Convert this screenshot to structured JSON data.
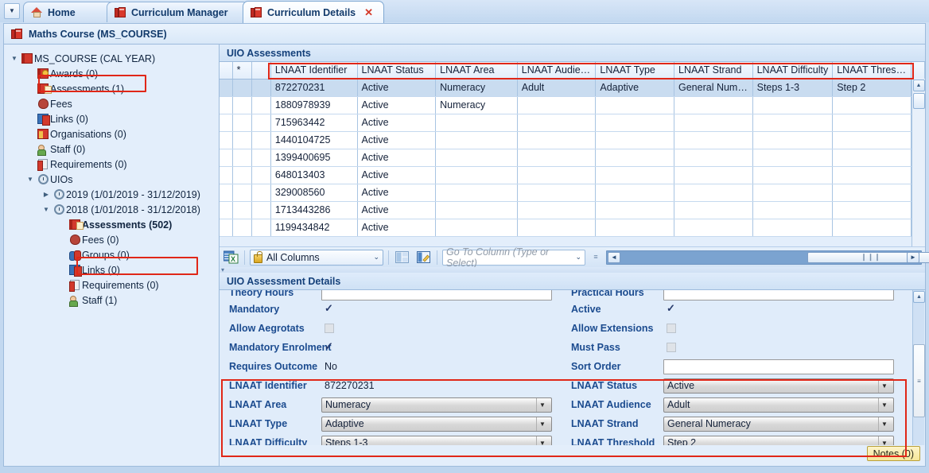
{
  "window": {
    "breadcrumb_title": "Maths Course (MS_COURSE)",
    "breadcrumb_icon": "book-icon"
  },
  "tabs": {
    "overflow_arrow": "▼",
    "items": [
      {
        "label": "Home",
        "icon": "home-icon",
        "active": false,
        "closable": false
      },
      {
        "label": "Curriculum Manager",
        "icon": "book-icon",
        "active": false,
        "closable": false
      },
      {
        "label": "Curriculum Details",
        "icon": "book-icon",
        "active": true,
        "closable": true,
        "close_glyph": "✕"
      }
    ]
  },
  "tree": {
    "nodes": [
      {
        "label": "MS_COURSE (CAL YEAR)",
        "indent": 0,
        "twisty": "▼",
        "icon": "book-icon",
        "bold": false,
        "highlight": false
      },
      {
        "label": "Awards (0)",
        "indent": 1,
        "twisty": "",
        "icon": "award-icon",
        "bold": false,
        "highlight": false
      },
      {
        "label": "Assessments (1)",
        "indent": 1,
        "twisty": "",
        "icon": "assessment-icon",
        "bold": false,
        "highlight": true
      },
      {
        "label": "Fees",
        "indent": 1,
        "twisty": "",
        "icon": "fees-icon",
        "bold": false,
        "highlight": false
      },
      {
        "label": "Links (0)",
        "indent": 1,
        "twisty": "",
        "icon": "links-icon",
        "bold": false,
        "highlight": false
      },
      {
        "label": "Organisations (0)",
        "indent": 1,
        "twisty": "",
        "icon": "organisations-icon",
        "bold": false,
        "highlight": false
      },
      {
        "label": "Staff (0)",
        "indent": 1,
        "twisty": "",
        "icon": "staff-icon",
        "bold": false,
        "highlight": false
      },
      {
        "label": "Requirements (0)",
        "indent": 1,
        "twisty": "",
        "icon": "requirements-icon",
        "bold": false,
        "highlight": false
      },
      {
        "label": "UIOs",
        "indent": 1,
        "twisty": "▼",
        "icon": "clock-icon",
        "bold": false,
        "highlight": false
      },
      {
        "label": "2019 (1/01/2019 - 31/12/2019)",
        "indent": 2,
        "twisty": "▶",
        "icon": "clock-icon",
        "bold": false,
        "highlight": false
      },
      {
        "label": "2018 (1/01/2018 - 31/12/2018)",
        "indent": 2,
        "twisty": "▼",
        "icon": "clock-icon",
        "bold": false,
        "highlight": false
      },
      {
        "label": "Assessments (502)",
        "indent": 3,
        "twisty": "",
        "icon": "assessment-icon",
        "bold": true,
        "highlight": true
      },
      {
        "label": "Fees (0)",
        "indent": 3,
        "twisty": "",
        "icon": "fees-icon",
        "bold": false,
        "highlight": false
      },
      {
        "label": "Groups (0)",
        "indent": 3,
        "twisty": "",
        "icon": "groups-icon",
        "bold": false,
        "highlight": false
      },
      {
        "label": "Links (0)",
        "indent": 3,
        "twisty": "",
        "icon": "links-icon",
        "bold": false,
        "highlight": false
      },
      {
        "label": "Requirements (0)",
        "indent": 3,
        "twisty": "",
        "icon": "requirements-icon",
        "bold": false,
        "highlight": false
      },
      {
        "label": "Staff (1)",
        "indent": 3,
        "twisty": "",
        "icon": "staff-icon",
        "bold": false,
        "highlight": false
      }
    ]
  },
  "grid_section": {
    "header": "UIO Assessments",
    "row_marker": "*",
    "columns": [
      "LNAAT Identifier",
      "LNAAT Status",
      "LNAAT Area",
      "LNAAT Audience",
      "LNAAT Type",
      "LNAAT Strand",
      "LNAAT Difficulty",
      "LNAAT Threshold"
    ],
    "rows": [
      {
        "selected": true,
        "cells": [
          "872270231",
          "Active",
          "Numeracy",
          "Adult",
          "Adaptive",
          "General Nume...",
          "Steps 1-3",
          "Step 2"
        ]
      },
      {
        "selected": false,
        "cells": [
          "1880978939",
          "Active",
          "Numeracy",
          "",
          "",
          "",
          "",
          ""
        ]
      },
      {
        "selected": false,
        "cells": [
          "715963442",
          "Active",
          "",
          "",
          "",
          "",
          "",
          ""
        ]
      },
      {
        "selected": false,
        "cells": [
          "1440104725",
          "Active",
          "",
          "",
          "",
          "",
          "",
          ""
        ]
      },
      {
        "selected": false,
        "cells": [
          "1399400695",
          "Active",
          "",
          "",
          "",
          "",
          "",
          ""
        ]
      },
      {
        "selected": false,
        "cells": [
          "648013403",
          "Active",
          "",
          "",
          "",
          "",
          "",
          ""
        ]
      },
      {
        "selected": false,
        "cells": [
          "329008560",
          "Active",
          "",
          "",
          "",
          "",
          "",
          ""
        ]
      },
      {
        "selected": false,
        "cells": [
          "1713443286",
          "Active",
          "",
          "",
          "",
          "",
          "",
          ""
        ]
      },
      {
        "selected": false,
        "cells": [
          "1199434842",
          "Active",
          "",
          "",
          "",
          "",
          "",
          ""
        ]
      }
    ]
  },
  "grid_toolbar": {
    "export_icon": "export-to-excel-icon",
    "columns_filter": {
      "label": "All Columns",
      "icon": "lock-icon",
      "arrow": "⌄"
    },
    "layout_icon": "column-layout-icon",
    "edit_layout_icon": "edit-layout-icon",
    "goto_column": {
      "placeholder": "Go To Column (Type or Select)",
      "value": "",
      "arrow": "⌄"
    },
    "scroll_left_glyph": "◄",
    "scroll_right_glyph": "►",
    "thumb_grip": "❙❙❙"
  },
  "details_section": {
    "header": "UIO Assessment Details",
    "rows": [
      {
        "left": {
          "label": "Theory Hours",
          "kind": "textbox",
          "value": "",
          "bold": true,
          "clipped": true
        },
        "right": {
          "label": "Practical Hours",
          "kind": "textbox",
          "value": "",
          "bold": true,
          "clipped": true
        },
        "highlighted": false
      },
      {
        "left": {
          "label": "Mandatory",
          "kind": "checkbox",
          "value": "checked",
          "bold": true
        },
        "right": {
          "label": "Active",
          "kind": "checkbox",
          "value": "checked",
          "bold": true
        },
        "highlighted": false
      },
      {
        "left": {
          "label": "Allow Aegrotats",
          "kind": "checkbox",
          "value": "unchecked",
          "bold": true
        },
        "right": {
          "label": "Allow Extensions",
          "kind": "checkbox",
          "value": "unchecked",
          "bold": true
        },
        "highlighted": false
      },
      {
        "left": {
          "label": "Mandatory Enrolment",
          "kind": "checkbox",
          "value": "checked",
          "bold": true
        },
        "right": {
          "label": "Must Pass",
          "kind": "checkbox",
          "value": "unchecked",
          "bold": true
        },
        "highlighted": false
      },
      {
        "left": {
          "label": "Requires Outcome",
          "kind": "text",
          "value": "No",
          "bold": true
        },
        "right": {
          "label": "Sort Order",
          "kind": "textbox",
          "value": "",
          "bold": true
        },
        "highlighted": false
      },
      {
        "left": {
          "label": "LNAAT Identifier",
          "kind": "text",
          "value": "872270231",
          "bold": false
        },
        "right": {
          "label": "LNAAT Status",
          "kind": "dropdown",
          "value": "Active",
          "bold": false
        },
        "highlighted": true
      },
      {
        "left": {
          "label": "LNAAT Area",
          "kind": "dropdown",
          "value": "Numeracy",
          "bold": false
        },
        "right": {
          "label": "LNAAT Audience",
          "kind": "dropdown",
          "value": "Adult",
          "bold": false
        },
        "highlighted": true
      },
      {
        "left": {
          "label": "LNAAT Type",
          "kind": "dropdown",
          "value": "Adaptive",
          "bold": false
        },
        "right": {
          "label": "LNAAT Strand",
          "kind": "dropdown",
          "value": "General Numeracy",
          "bold": false
        },
        "highlighted": true
      },
      {
        "left": {
          "label": "LNAAT Difficulty",
          "kind": "dropdown",
          "value": "Steps 1-3",
          "bold": false
        },
        "right": {
          "label": "LNAAT Threshold",
          "kind": "dropdown",
          "value": "Step 2",
          "bold": false
        },
        "highlighted": true
      }
    ],
    "dropdown_arrow": "▼",
    "scroll_up_glyph": "▲",
    "scroll_down_glyph": "▼",
    "thumb_grip": "≡"
  },
  "footer": {
    "notes_label": "Notes (0)"
  },
  "colors": {
    "highlight_red": "#e02718",
    "header_blue": "#14407a",
    "label_blue": "#1b4b8f",
    "selection_blue": "#c9dcf0",
    "notes_yellow": "#f6e79a"
  }
}
